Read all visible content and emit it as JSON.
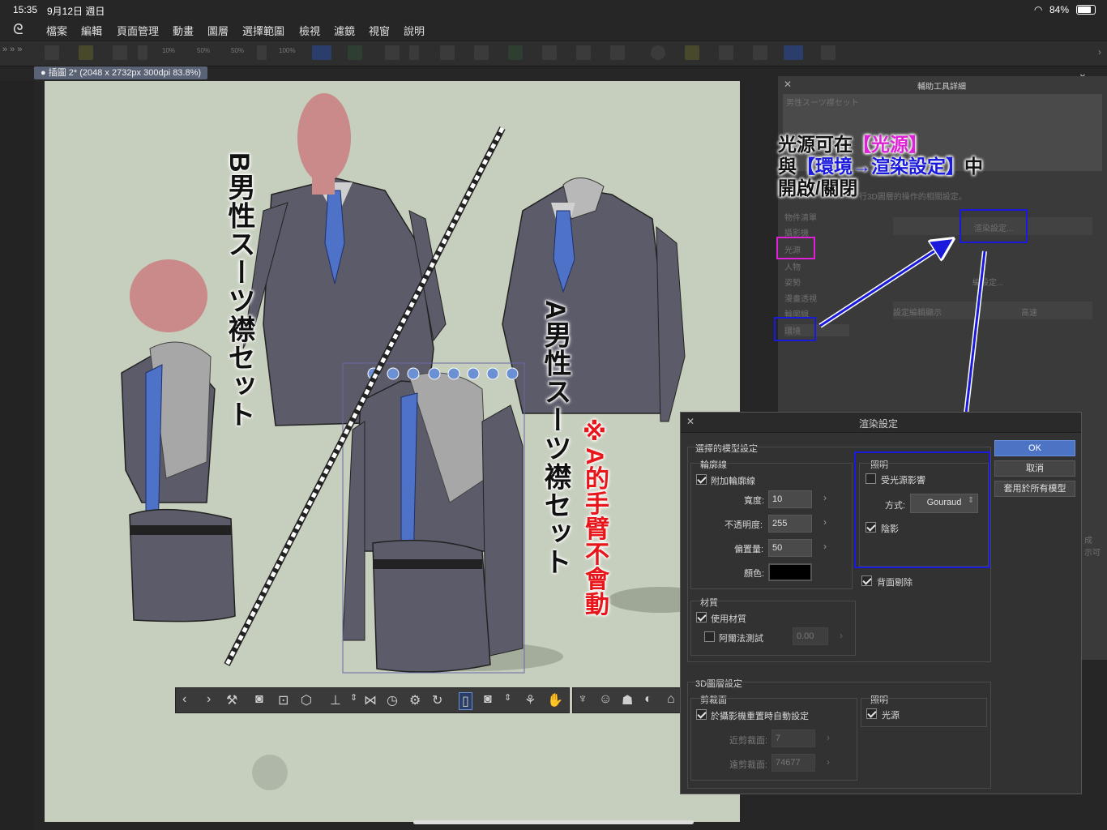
{
  "status": {
    "time": "15:35",
    "date": "9月12日 週日",
    "battery": "84%"
  },
  "menu": [
    "檔案",
    "編輯",
    "頁面管理",
    "動畫",
    "圖層",
    "選擇範圍",
    "檢視",
    "濾鏡",
    "視窗",
    "說明"
  ],
  "toolbar": {
    "chevrons": "» » »",
    "labels": [
      "10%",
      "50%",
      "50%",
      "100%"
    ]
  },
  "document_tab": "插圖 2* (2048 x 2732px 300dpi 83.8%)",
  "canvas": {
    "label_b": "B男性スーツ襟セット",
    "label_a": "A男性スーツ襟セット",
    "note": "※A的手臂不會動"
  },
  "tool_panel": {
    "title": "輔助工具詳細",
    "preset": "男性スーツ襟セット",
    "desc": "行3D圖層的操作的相關設定。",
    "categories": [
      "物件清單",
      "攝影機",
      "光源",
      "人物",
      "姿勢",
      "漫畫透視",
      "輪廓線",
      "環境"
    ],
    "render_btn": "渲染設定...",
    "other_btn": "編設定...",
    "render_mode": "設定編輯顯示",
    "quality": "高速",
    "side_text": "成 示可"
  },
  "annotation": {
    "line1": "光源可在【光源】",
    "line2a": "與",
    "line2b": "【環境→渲染設定】",
    "line2c": "中",
    "line3": "開啟/關閉",
    "colors": {
      "magenta": "#e020d8",
      "blue": "#1a1adc"
    }
  },
  "render_dialog": {
    "title": "渲染設定",
    "section_model": "選擇的模型設定",
    "outline_group": "輪廓線",
    "add_outline": "附加輪廓線",
    "width_label": "寬度:",
    "width_value": "10",
    "opacity_label": "不透明度:",
    "opacity_value": "255",
    "offset_label": "偏置量:",
    "offset_value": "50",
    "color_label": "顏色:",
    "lighting_group": "照明",
    "affected_by_light": "受光源影響",
    "method_label": "方式:",
    "method_value": "Gouraud",
    "shadow": "陰影",
    "backface": "背面剔除",
    "material_group": "材質",
    "use_material": "使用材質",
    "alpha_test": "阿爾法測試",
    "alpha_value": "0.00",
    "section_layer": "3D圖層設定",
    "clip_group": "剪裁面",
    "auto_clip": "於攝影機重置時自動設定",
    "near_label": "近剪裁面:",
    "near_value": "7",
    "far_label": "遠剪裁面:",
    "far_value": "74677",
    "lighting_group2": "照明",
    "light_source": "光源",
    "ok": "OK",
    "cancel": "取消",
    "apply_all": "套用於所有模型"
  }
}
